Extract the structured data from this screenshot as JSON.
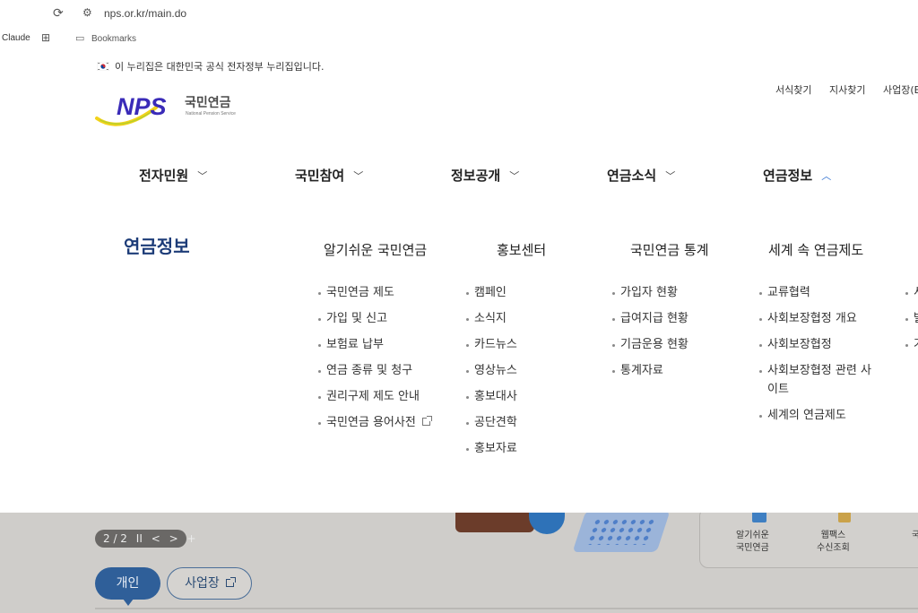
{
  "browser": {
    "url": "nps.or.kr/main.do",
    "bookmarks": {
      "profile": "Claude",
      "folder_label": "Bookmarks"
    }
  },
  "notice": "이 누리집은 대한민국 공식 전자정부 누리집입니다.",
  "header": {
    "logo": {
      "mark": "NPS",
      "korean": "국민연금",
      "english": "National Pension Service"
    },
    "util_links": [
      "서식찾기",
      "지사찾기",
      "사업장(E"
    ]
  },
  "gnb": [
    "전자민원",
    "국민참여",
    "정보공개",
    "연금소식",
    "연금정보"
  ],
  "mega": {
    "title": "연금정보",
    "columns": [
      {
        "title": "알기쉬운 국민연금",
        "items": [
          "국민연금 제도",
          "가입 및 신고",
          "보험료 납부",
          "연금 종류 및 청구",
          "권리구제 제도 안내",
          "국민연금 용어사전"
        ]
      },
      {
        "title": "홍보센터",
        "items": [
          "캠페인",
          "소식지",
          "카드뉴스",
          "영상뉴스",
          "홍보대사",
          "공단견학",
          "홍보자료"
        ]
      },
      {
        "title": "국민연금 통계",
        "items": [
          "가입자 현황",
          "급여지급 현황",
          "기금운용 현황",
          "통계자료"
        ]
      },
      {
        "title": "세계 속 연금제도",
        "items": [
          "교류협력",
          "사회보장협정 개요",
          "사회보장협정",
          "사회보장협정 관련 사이트",
          "세계의 연금제도"
        ]
      }
    ],
    "partial_items": [
      "서",
      "발",
      "기"
    ]
  },
  "below": {
    "slider": {
      "counter": "2 / 2",
      "pause": "II",
      "prev": "<",
      "next": ">",
      "more": "+"
    },
    "tabs": {
      "personal": "개인",
      "business": "사업장"
    },
    "quick_menu": [
      "알기쉬운\n국민연금",
      "웹팩스\n수신조회",
      "국"
    ]
  },
  "colors": {
    "brand_navy": "#1d3c78",
    "brand_blue": "#2f6fd0",
    "logo_purple": "#3a2bb8",
    "logo_yellow": "#f2d21a"
  }
}
